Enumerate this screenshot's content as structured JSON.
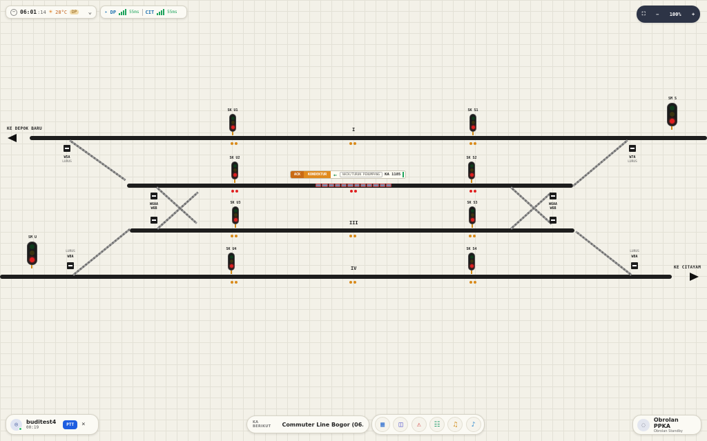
{
  "header": {
    "clock": {
      "time": "06:01",
      "seconds": ":14",
      "temp": "28°C",
      "tag": "DP"
    },
    "stations": [
      {
        "name": "DP",
        "ms": "55ms"
      },
      {
        "name": "CIT",
        "ms": "55ms"
      }
    ],
    "zoom": {
      "level": "100%",
      "minus": "−",
      "plus": "+",
      "fit": "⛶"
    }
  },
  "layout": {
    "destinations": {
      "west": "KE DEPOK BARU",
      "east": "KE CITAYAM"
    },
    "tracks": [
      "I",
      "III",
      "IV"
    ],
    "signals": {
      "u1": "SK U1",
      "s1": "SK S1",
      "u2": "SK U2",
      "s2": "SK S2",
      "u3": "SK U3",
      "s3": "SK S3",
      "u4": "SK U4",
      "s4": "SK S4",
      "msu": "SM U",
      "mss": "SM S"
    },
    "switches": {
      "w5a": "W5A",
      "w5a_sub": "LURUS",
      "w7a": "W7A",
      "w7a_sub": "LURUS",
      "w6a_left": "W6AA\nW6B",
      "w6b_left": "W8A",
      "w6a_right": "W6AA\nW6B",
      "w6b_right": "W8A",
      "w8a_left_sub": "LURUS",
      "w8a_left": "W8A",
      "w9a_right_sub": "LURUS",
      "w9a_right": "W8A"
    }
  },
  "train_bar": {
    "ack": "ACK",
    "role": "KONDEKTUR",
    "arrow": "←",
    "action": "NAIK/TURUN PENUMPANG",
    "train": "KA 1185"
  },
  "footer": {
    "user": {
      "name": "buditest4",
      "time": "00:19"
    },
    "ptt": "PTT",
    "close": "×",
    "next_label": "KA BERIKUT",
    "next_value": "Commuter Line Bogor (06...",
    "tools": [
      "calendar-icon",
      "book-icon",
      "alert-icon",
      "sliders-icon",
      "bell-icon",
      "music-icon"
    ],
    "chat": {
      "title": "Obrolan PPKA",
      "subtitle": "Obrolan Standby"
    }
  },
  "colors": {
    "background": "#f3f1e8",
    "track": "#1d1d1d",
    "signal_red": "#e02020",
    "ack": "#c96a14",
    "ptt": "#1e5ee0",
    "zoom_bg": "#2d3446"
  }
}
